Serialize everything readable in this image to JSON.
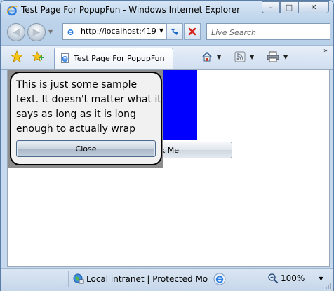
{
  "window": {
    "title": "Test Page For PopupFun - Windows Internet Explorer",
    "controls": {
      "minimize": "–",
      "maximize": "□",
      "close": "✕"
    }
  },
  "nav": {
    "back": "◀",
    "forward": "▶",
    "address_url": "http://localhost:419",
    "search_placeholder": "Live Search"
  },
  "tabs": [
    {
      "label": "Test Page For PopupFun"
    }
  ],
  "toolbar": {
    "home_icon": "home-icon",
    "feeds_icon": "feeds-icon",
    "print_icon": "print-icon",
    "overflow": "»"
  },
  "page": {
    "popup_text": "This is just some sample text. It doesn't matter what it says as long as it is long enough to actually wrap",
    "close_label": "Close",
    "click_me_label": "Click Me",
    "colors": {
      "box": "#0000ff",
      "backdrop": "#8c8c8c",
      "popup_bg": "#f1f1f1"
    }
  },
  "status": {
    "zone_text": "Local intranet | Protected Mode: Off",
    "zoom": "100%"
  }
}
